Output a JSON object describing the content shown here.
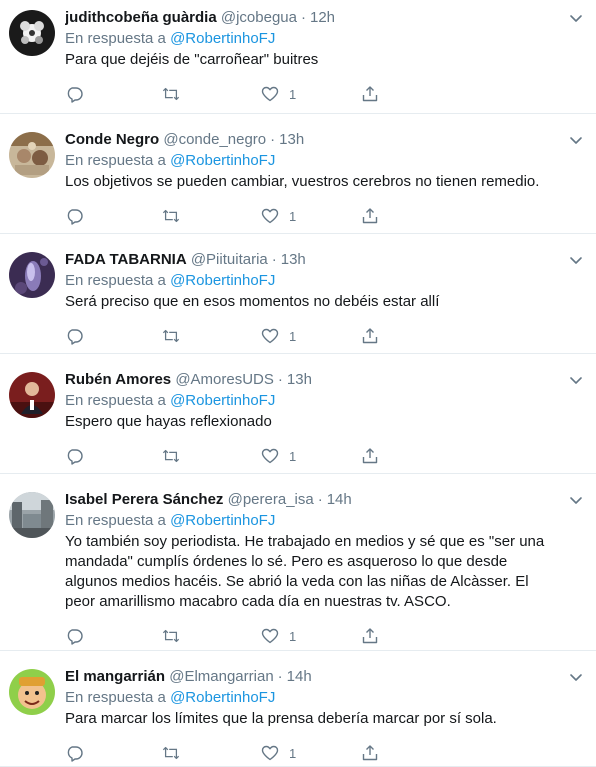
{
  "tweets": [
    {
      "name": "judithcobeña guàrdia",
      "handle": "@jcobegua",
      "time": "12h",
      "reply_prefix": "En respuesta a",
      "reply_to": "@RobertinhoFJ",
      "text_lines": [
        "Para que dejéis de \"carroñear\" buitres"
      ],
      "likes": "1",
      "avatar_icon": "dark-flower-avatar"
    },
    {
      "name": "Conde Negro",
      "handle": "@conde_negro",
      "time": "13h",
      "reply_prefix": "En respuesta a",
      "reply_to": "@RobertinhoFJ",
      "text_lines": [
        "Los objetivos se pueden cambiar, vuestros cerebros no tienen remedio."
      ],
      "likes": "1",
      "avatar_icon": "ornate-painting-avatar"
    },
    {
      "name": "FADA TABARNIA",
      "handle": "@Piituitaria",
      "time": "13h",
      "reply_prefix": "En respuesta a",
      "reply_to": "@RobertinhoFJ",
      "text_lines": [
        "Será preciso que en esos momentos no debéis estar  allí"
      ],
      "likes": "1",
      "avatar_icon": "purple-fairy-avatar"
    },
    {
      "name": "Rubén Amores",
      "handle": "@AmoresUDS",
      "time": "13h",
      "reply_prefix": "En respuesta a",
      "reply_to": "@RobertinhoFJ",
      "text_lines": [
        "Espero que hayas reflexionado"
      ],
      "likes": "1",
      "avatar_icon": "man-in-suit-avatar"
    },
    {
      "name": "Isabel Perera Sánchez",
      "handle": "@perera_isa",
      "time": "14h",
      "reply_prefix": "En respuesta a",
      "reply_to": "@RobertinhoFJ",
      "text_lines": [
        "Yo también soy periodista. He trabajado en medios y sé que es \"ser una",
        "mandada\" cumplís órdenes lo sé. Pero es asqueroso lo que desde",
        "algunos medios hacéis. Se abrió la veda con las niñas de Alcàsser. El",
        "peor amarillismo macabro cada día en nuestras tv. ASCO."
      ],
      "likes": "1",
      "avatar_icon": "city-street-avatar"
    },
    {
      "name": "El mangarrián",
      "handle": "@Elmangarrian",
      "time": "14h",
      "reply_prefix": "En respuesta a",
      "reply_to": "@RobertinhoFJ",
      "text_lines": [
        "Para marcar los límites que la prensa debería marcar por sí sola."
      ],
      "likes": "1",
      "avatar_icon": "cartoon-face-avatar"
    }
  ],
  "colors": {
    "link": "#1b95e0",
    "secondary_text": "#657786",
    "primary_text": "#14171a",
    "divider": "#e6ecf0"
  },
  "icons": {
    "reply": "reply-icon",
    "retweet": "retweet-icon",
    "like": "heart-icon",
    "share": "share-icon",
    "menu": "chevron-down-icon"
  }
}
